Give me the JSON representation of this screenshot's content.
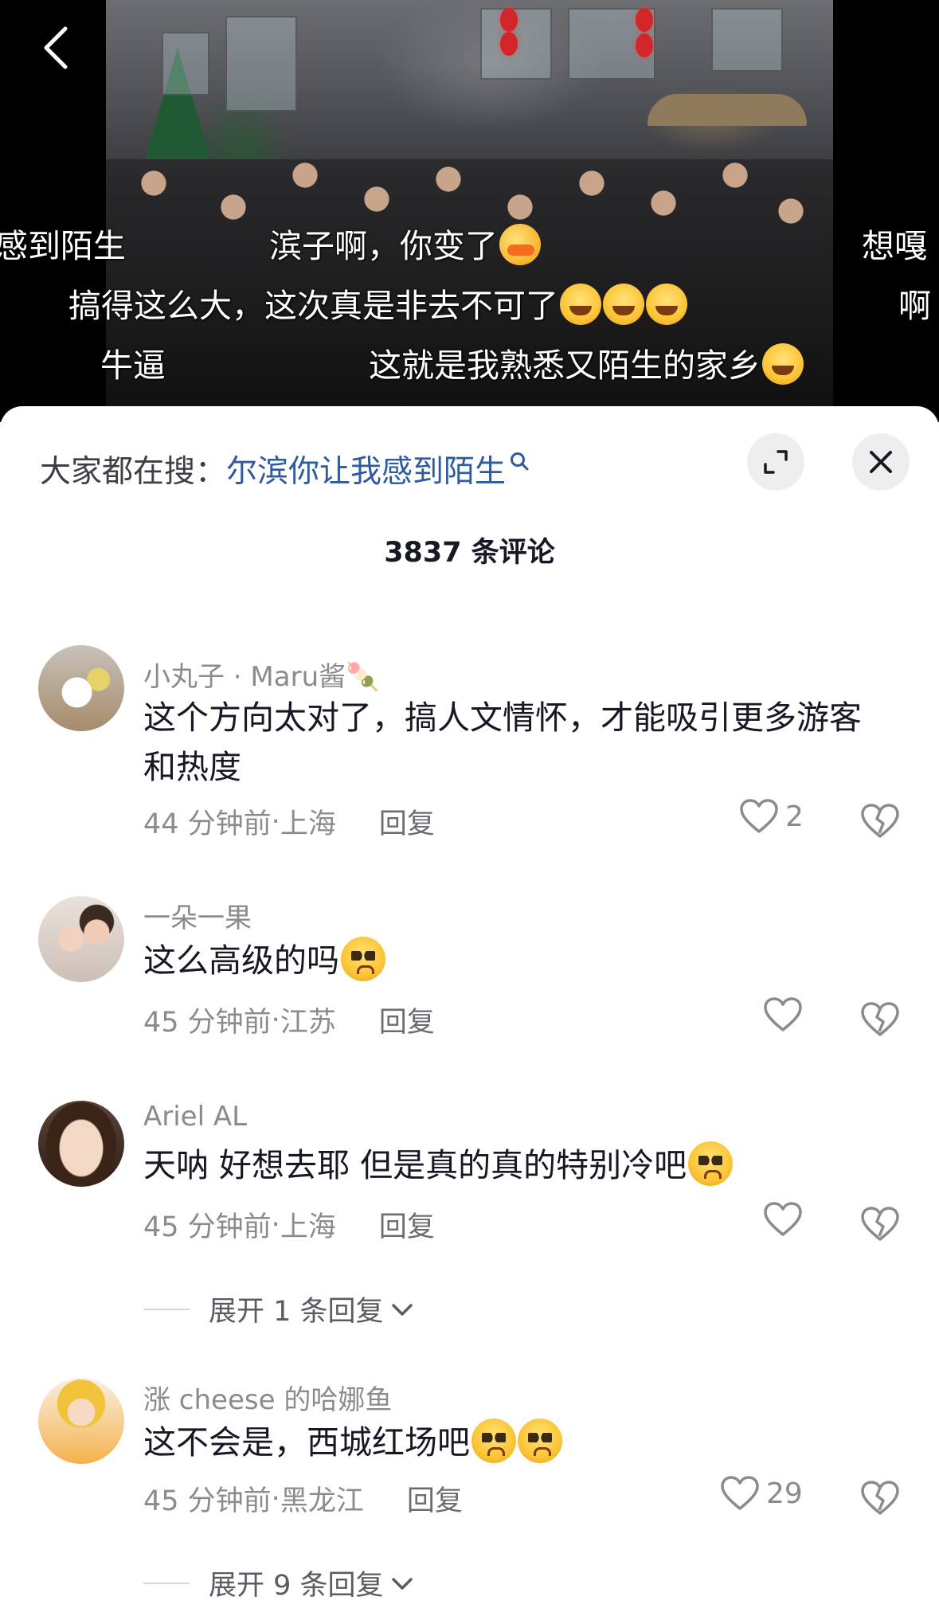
{
  "video": {
    "danmaku": [
      {
        "id": "d1",
        "text": "感到陌生",
        "emoji": ""
      },
      {
        "id": "d2",
        "text": "滨子啊，你变了",
        "emoji": "duck"
      },
      {
        "id": "d3",
        "text": "想嘎",
        "emoji": ""
      },
      {
        "id": "d4",
        "text": "搞得这么大，这次真是非去不可了",
        "emoji": "grin"
      },
      {
        "id": "d5",
        "text": "啊",
        "emoji": ""
      },
      {
        "id": "d6",
        "text": "牛逼",
        "emoji": ""
      },
      {
        "id": "d7",
        "text": "这就是我熟悉又陌生的家乡",
        "emoji": "grin"
      }
    ]
  },
  "search": {
    "prefix": "大家都在搜：",
    "term": "尔滨你让我感到陌生"
  },
  "comment_count": "3837 条评论",
  "comments": [
    {
      "username": "小丸子 · Maru酱🍡",
      "text": "这个方向太对了，搞人文情怀，才能吸引更多游客和热度",
      "time": "44 分钟前",
      "location": "上海",
      "reply_label": "回复",
      "likes": "2"
    },
    {
      "username": "一朵一果",
      "text": "这么高级的吗",
      "time": "45 分钟前",
      "location": "江苏",
      "reply_label": "回复",
      "likes": ""
    },
    {
      "username": "Ariel AL",
      "text": "天呐 好想去耶 但是真的真的特别冷吧",
      "time": "45 分钟前",
      "location": "上海",
      "reply_label": "回复",
      "likes": "",
      "expand_label": "展开 1 条回复"
    },
    {
      "username": "涨 cheese 的哈娜鱼",
      "text": "这不会是，西城红场吧",
      "time": "45 分钟前",
      "location": "黑龙江",
      "reply_label": "回复",
      "likes": "29",
      "expand_label": "展开 9 条回复"
    }
  ],
  "meta_separator": " · "
}
